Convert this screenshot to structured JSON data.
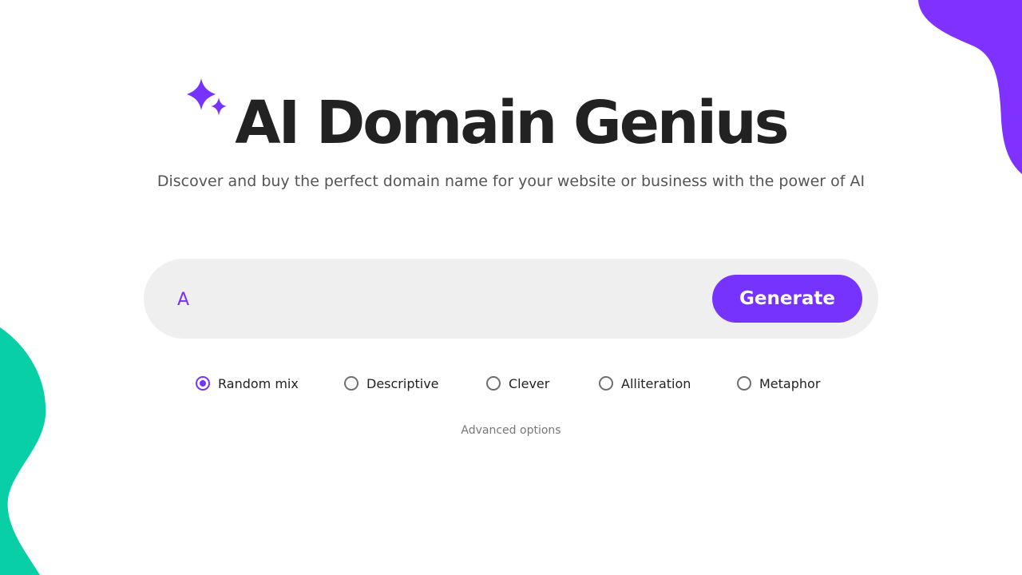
{
  "header": {
    "title": "AI Domain Genius",
    "subtitle": "Discover and buy the perfect domain name for your website or business with the power of AI"
  },
  "search": {
    "value": "",
    "placeholder": "A",
    "button_label": "Generate"
  },
  "styles": {
    "selected": "Random mix",
    "options": [
      {
        "label": "Random mix",
        "checked": true
      },
      {
        "label": "Descriptive",
        "checked": false
      },
      {
        "label": "Clever",
        "checked": false
      },
      {
        "label": "Alliteration",
        "checked": false
      },
      {
        "label": "Metaphor",
        "checked": false
      }
    ]
  },
  "advanced_label": "Advanced options",
  "colors": {
    "accent": "#7633fe",
    "blob_purple": "#7f32ff",
    "blob_green": "#08cfa6",
    "title": "#222222",
    "search_bg": "#efefef"
  },
  "icons": {
    "sparkle": "sparkles-icon"
  }
}
